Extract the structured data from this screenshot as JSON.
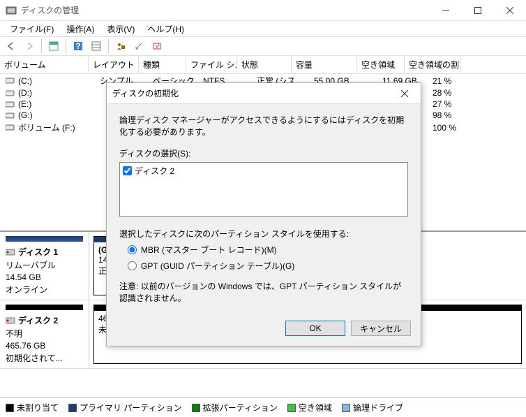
{
  "title": "ディスクの管理",
  "menu": {
    "file": "ファイル(F)",
    "action": "操作(A)",
    "view": "表示(V)",
    "help": "ヘルプ(H)"
  },
  "columns": {
    "volume": "ボリューム",
    "layout": "レイアウト",
    "type": "種類",
    "fs": "ファイル システム",
    "state": "状態",
    "capacity": "容量",
    "free": "空き領域",
    "freepct": "空き領域の割..."
  },
  "rows": [
    {
      "name": "(C:)",
      "layout": "シンプル",
      "type": "ベーシック",
      "fs": "NTFS",
      "state": "正常 (シス...",
      "capacity": "55.00 GB",
      "free": "11.69 GB",
      "freepct": "21 %"
    },
    {
      "name": "(D:)",
      "freepct": "28 %"
    },
    {
      "name": "(E:)",
      "freepct": "27 %"
    },
    {
      "name": "(G:)",
      "freepct": "98 %"
    },
    {
      "name": "ボリューム (F:)",
      "freepct": "100 %"
    }
  ],
  "disks": [
    {
      "label": "ディスク 1",
      "media": "リムーバブル",
      "size": "14.54 GB",
      "status": "オンライン",
      "iconColor": "#444",
      "stripe": "blue",
      "parts": [
        {
          "label": "(G:)",
          "size": "14.54 G",
          "state": "正常 (",
          "type": "primary"
        }
      ]
    },
    {
      "label": "ディスク 2",
      "media": "不明",
      "size": "465.76 GB",
      "status": "初期化されて...",
      "iconColor": "#cc0000",
      "stripe": "black",
      "parts": [
        {
          "label": "",
          "size": "465.76 GB",
          "state": "未割り当て",
          "type": "unalloc"
        }
      ]
    }
  ],
  "legend": {
    "unalloc": "未割り当て",
    "primary": "プライマリ パーティション",
    "extended": "拡張パーティション",
    "free": "空き領域",
    "logical": "論理ドライブ"
  },
  "dialog": {
    "title": "ディスクの初期化",
    "intro": "論理ディスク マネージャーがアクセスできるようにするにはディスクを初期化する必要があります。",
    "select_label": "ディスクの選択(S):",
    "disk_item": "ディスク 2",
    "style_label": "選択したディスクに次のパーティション スタイルを使用する:",
    "mbr": "MBR (マスター ブート レコード)(M)",
    "gpt": "GPT (GUID パーティション テーブル)(G)",
    "note": "注意: 以前のバージョンの Windows では、GPT パーティション スタイルが認識されません。",
    "ok": "OK",
    "cancel": "キャンセル"
  }
}
